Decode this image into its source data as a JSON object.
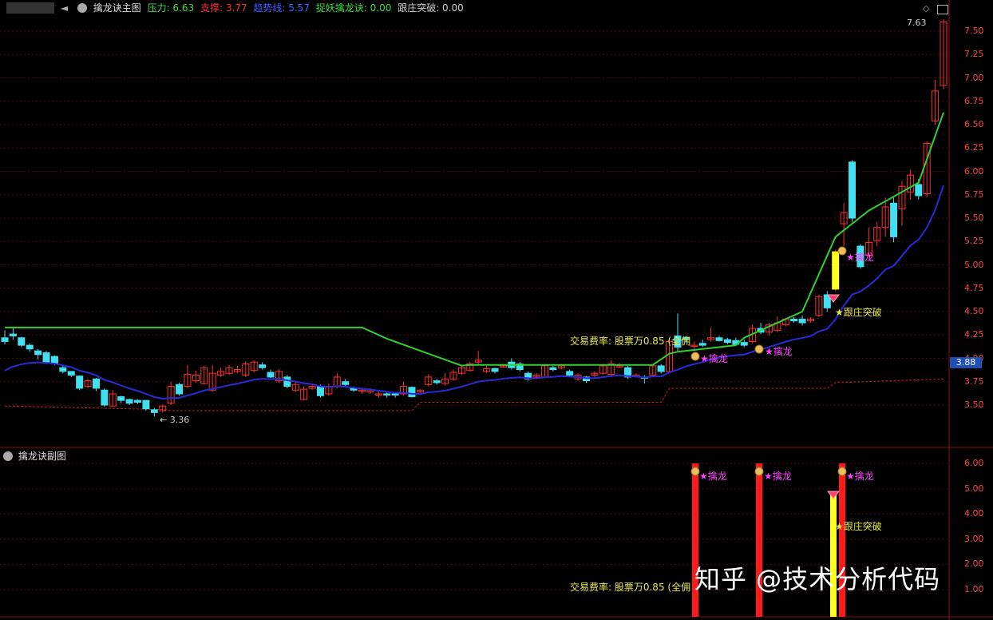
{
  "header": {
    "back_glyph": "◄",
    "title": "擒龙诀主图",
    "indicators": [
      {
        "label": "压力: 6.63",
        "color": "#3cdc3c"
      },
      {
        "label": "支撑: 3.77",
        "color": "#ff3030"
      },
      {
        "label": "趋势线: 5.57",
        "color": "#3a5cff"
      },
      {
        "label": "捉妖擒龙诀: 0.00",
        "color": "#3cdc3c"
      },
      {
        "label": "跟庄突破: 0.00",
        "color": "#cccccc"
      }
    ]
  },
  "sub_header": {
    "title": "擒龙诀副图"
  },
  "main_axis": {
    "ticks": [
      "7.50",
      "7.25",
      "7.00",
      "6.75",
      "6.50",
      "6.25",
      "6.00",
      "5.75",
      "5.50",
      "5.25",
      "5.00",
      "4.75",
      "4.50",
      "4.25",
      "4.00",
      "3.75",
      "3.50"
    ]
  },
  "sub_axis": {
    "ticks": [
      "6.00",
      "5.00",
      "4.00",
      "3.00",
      "2.00",
      "1.00"
    ]
  },
  "price_tag": "3.88",
  "annotations": {
    "high": "7.63",
    "low": "3.36",
    "fee_text": "交易费率: 股票万0.85 (全佣",
    "qinlong": "擒龙",
    "genzhuang": "跟庄突破"
  },
  "watermark": "知乎 @技术分析代码",
  "icons": {
    "diamond": "diamond-icon",
    "window": "window-icon"
  },
  "colors": {
    "up": "#ff3030",
    "down": "#40e0f0",
    "trend": "#2a2ad8",
    "pressure": "#2fd02f",
    "support": "#c02020",
    "signal_yellow": "#ffff20"
  }
}
